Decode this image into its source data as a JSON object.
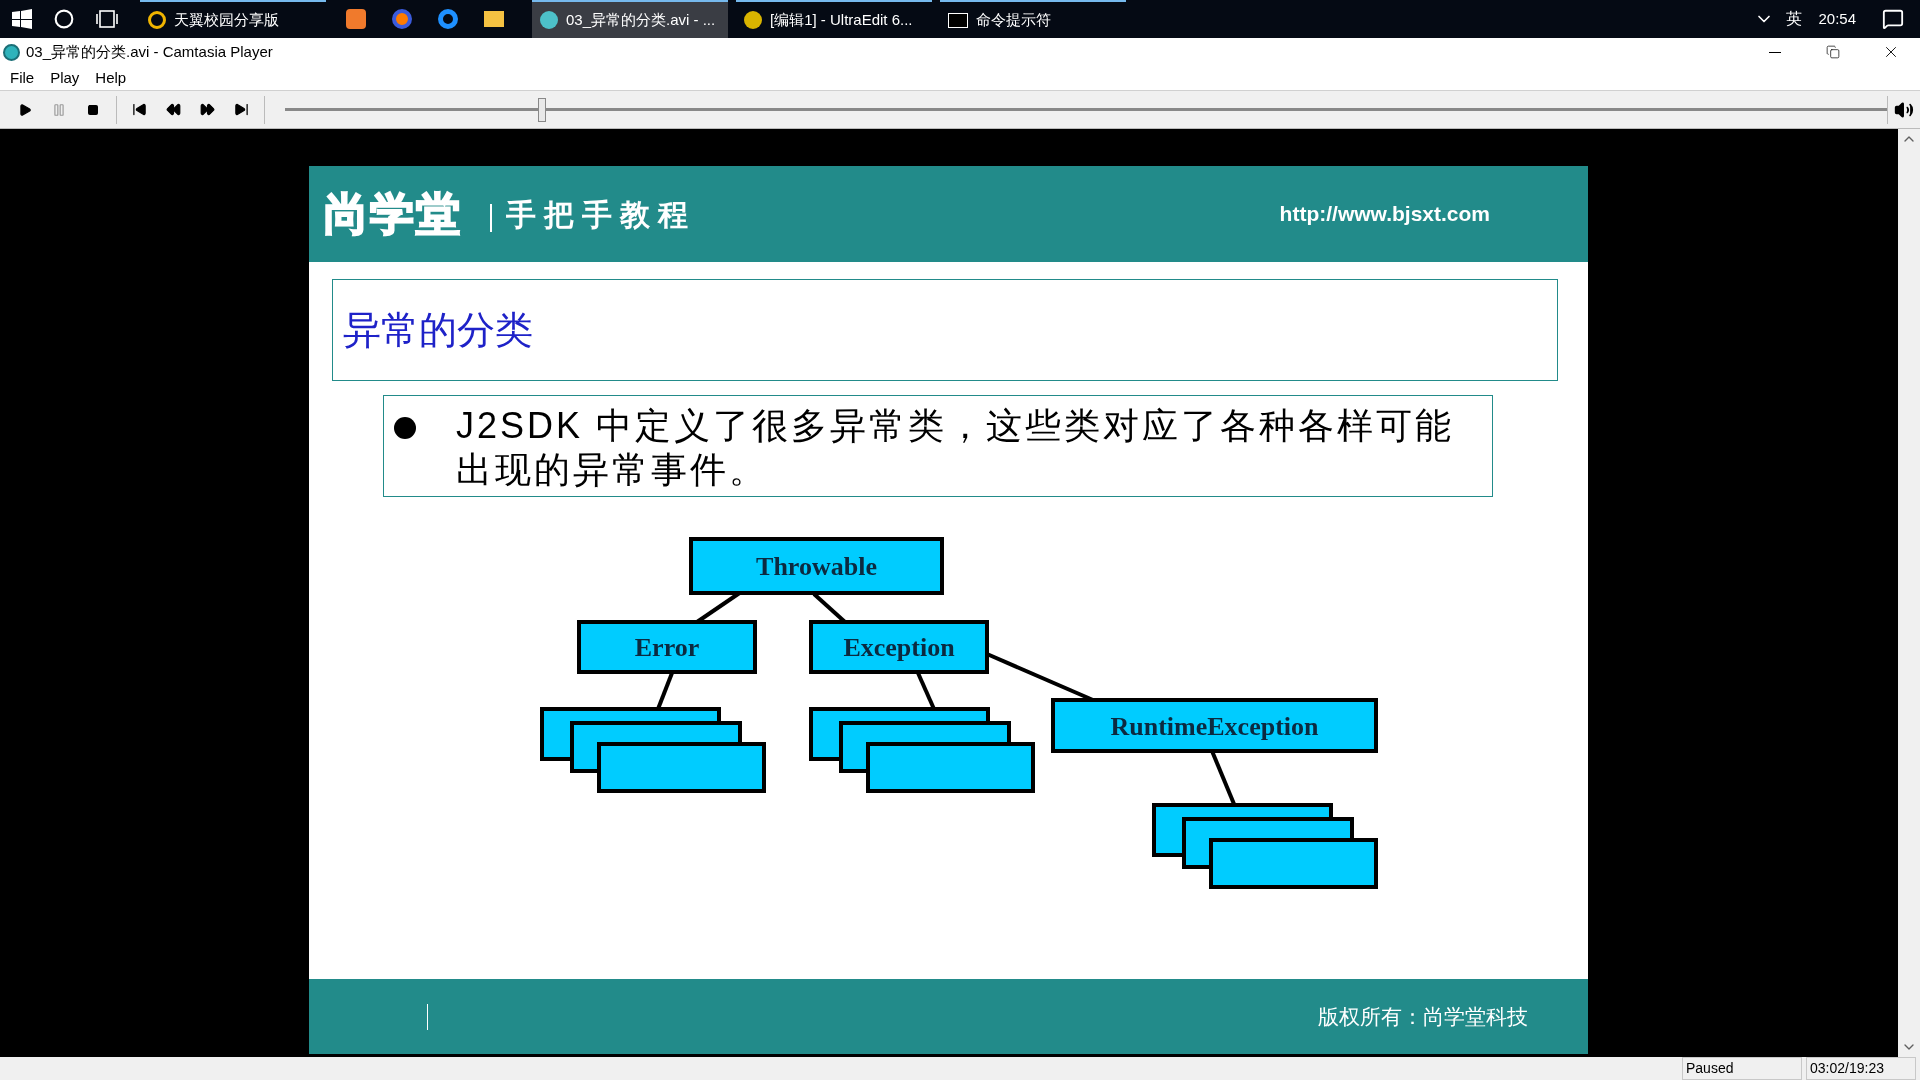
{
  "taskbar": {
    "items": [
      {
        "label": "天翼校园分享版",
        "selected": false
      },
      {
        "label": "03_异常的分类.avi - ...",
        "selected": true
      },
      {
        "label": "[编辑1] - UltraEdit 6...",
        "selected": false
      },
      {
        "label": "命令提示符",
        "selected": false
      }
    ],
    "ime": "英",
    "clock": "20:54"
  },
  "window": {
    "title": "03_异常的分类.avi - Camtasia Player"
  },
  "menu": [
    "File",
    "Play",
    "Help"
  ],
  "player": {
    "seek": {
      "level": 0.16
    }
  },
  "slide": {
    "logo": "尚学堂",
    "subtitle": "手把手教程",
    "url": "http://www.bjsxt.com",
    "heading": "异常的分类",
    "bullet": {
      "lead": "J2SDK",
      "text": "中定义了很多异常类，这些类对应了各种各样可能出现的异常事件。"
    },
    "diagram": {
      "nodes": [
        {
          "label": "Throwable"
        },
        {
          "label": "Error"
        },
        {
          "label": "Exception"
        },
        {
          "label": "RuntimeException"
        }
      ]
    },
    "footer": "版权所有：尚学堂科技"
  },
  "status_bar": {
    "state": "Paused",
    "time": "03:02/19:23"
  }
}
